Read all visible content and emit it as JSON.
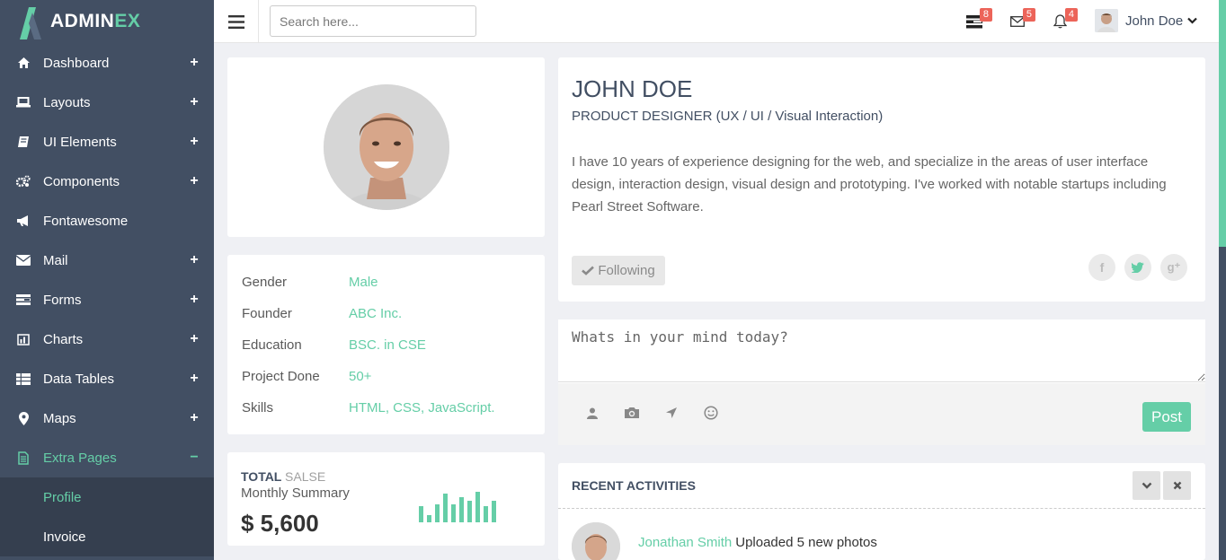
{
  "brand": {
    "name_main": "ADMIN",
    "name_accent": "EX"
  },
  "sidebar": {
    "items": [
      {
        "label": "Dashboard",
        "icon": "home-icon",
        "toggle": "+"
      },
      {
        "label": "Layouts",
        "icon": "laptop-icon",
        "toggle": "+"
      },
      {
        "label": "UI Elements",
        "icon": "book-icon",
        "toggle": "+"
      },
      {
        "label": "Components",
        "icon": "cogs-icon",
        "toggle": "+"
      },
      {
        "label": "Fontawesome",
        "icon": "bullhorn-icon",
        "toggle": ""
      },
      {
        "label": "Mail",
        "icon": "envelope-icon",
        "toggle": "+"
      },
      {
        "label": "Forms",
        "icon": "tasks-icon",
        "toggle": "+"
      },
      {
        "label": "Charts",
        "icon": "bar-chart-icon",
        "toggle": "+"
      },
      {
        "label": "Data Tables",
        "icon": "table-icon",
        "toggle": "+"
      },
      {
        "label": "Maps",
        "icon": "map-marker-icon",
        "toggle": "+"
      },
      {
        "label": "Extra Pages",
        "icon": "file-icon",
        "toggle": "−"
      }
    ],
    "subitems": [
      {
        "label": "Profile"
      },
      {
        "label": "Invoice"
      }
    ]
  },
  "header": {
    "search_placeholder": "Search here...",
    "tasks_count": "8",
    "mail_count": "5",
    "notify_count": "4",
    "user_name": "John Doe"
  },
  "profile": {
    "name": "JOHN DOE",
    "role": "PRODUCT DESIGNER (UX / UI / Visual Interaction)",
    "bio": "I have 10 years of experience designing for the web, and specialize in the areas of user interface design, interaction design, visual design and prototyping. I've worked with notable startups including Pearl Street Software.",
    "follow_label": "Following",
    "social": {
      "facebook": "f",
      "google": "g⁺"
    }
  },
  "info": [
    {
      "key": "Gender",
      "value": "Male"
    },
    {
      "key": "Founder",
      "value": "ABC Inc."
    },
    {
      "key": "Education",
      "value": "BSC. in CSE"
    },
    {
      "key": "Project Done",
      "value": "50+"
    },
    {
      "key": "Skills",
      "value": "HTML, CSS, JavaScript."
    }
  ],
  "sales": {
    "title": "TOTAL",
    "title_light": "SALSE",
    "subtitle": "Monthly Summary",
    "amount": "$ 5,600",
    "bar_color": "#65cea7"
  },
  "post": {
    "placeholder": "Whats in your mind today?",
    "button": "Post"
  },
  "activities": {
    "title": "RECENT ACTIVITIES",
    "items": [
      {
        "user": "Jonathan Smith",
        "text": "Uploaded 5 new photos"
      }
    ]
  },
  "colors": {
    "accent": "#65cea7",
    "sidebar": "#424f63",
    "badge": "#ec6459"
  }
}
